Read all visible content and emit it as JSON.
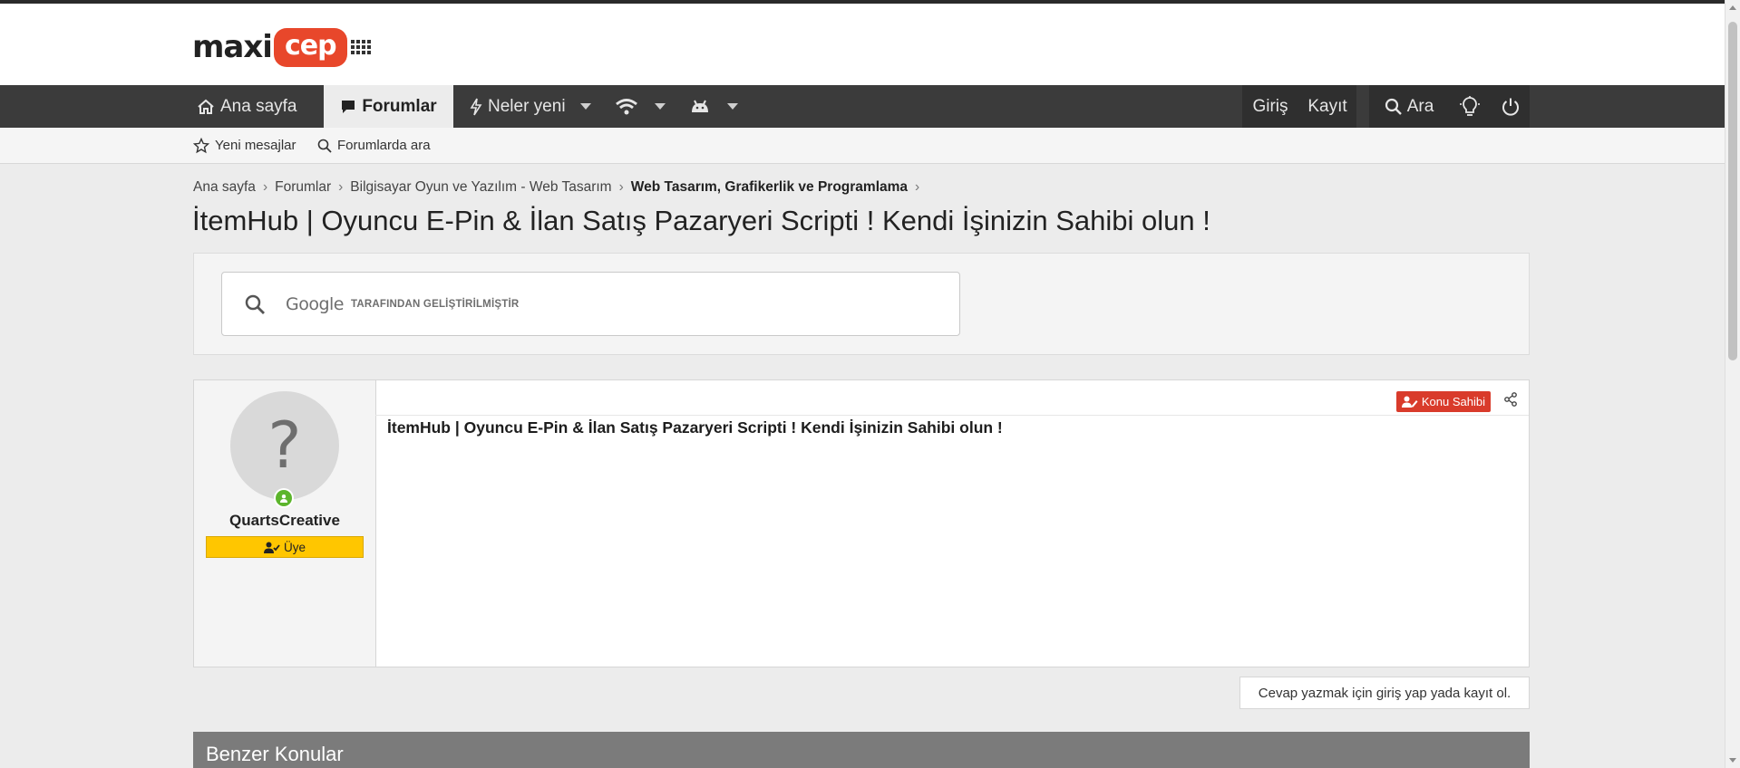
{
  "logo": {
    "part1": "maxi",
    "part2": "cep"
  },
  "nav": {
    "home": "Ana sayfa",
    "forums": "Forumlar",
    "whats_new": "Neler yeni",
    "login": "Giriş",
    "register": "Kayıt",
    "search": "Ara"
  },
  "subnav": {
    "new_posts": "Yeni mesajlar",
    "search_forums": "Forumlarda ara"
  },
  "breadcrumb": {
    "items": [
      "Ana sayfa",
      "Forumlar",
      "Bilgisayar Oyun ve Yazılım - Web Tasarım",
      "Web Tasarım, Grafikerlik ve Programlama"
    ]
  },
  "page": {
    "title": "İtemHub | Oyuncu E-Pin & İlan Satış Pazaryeri Scripti ! Kendi İşinizin Sahibi olun !"
  },
  "search": {
    "brand": "Google",
    "powered_by": "TARAFINDAN GELİŞTİRİLMİŞTİR"
  },
  "post": {
    "avatar_glyph": "?",
    "username": "QuartsCreative",
    "role": "Üye",
    "owner_badge": "Konu Sahibi",
    "body": "İtemHub | Oyuncu E-Pin & İlan Satış Pazaryeri Scripti ! Kendi İşinizin Sahibi olun !"
  },
  "reply_note": "Cevap yazmak için giriş yap yada kayıt ol.",
  "similar": {
    "title": "Benzer Konular"
  },
  "colors": {
    "accent": "#e8472b",
    "navbar": "#3b3b3b",
    "role_badge": "#ffc600",
    "owner_badge": "#d93b2b"
  }
}
